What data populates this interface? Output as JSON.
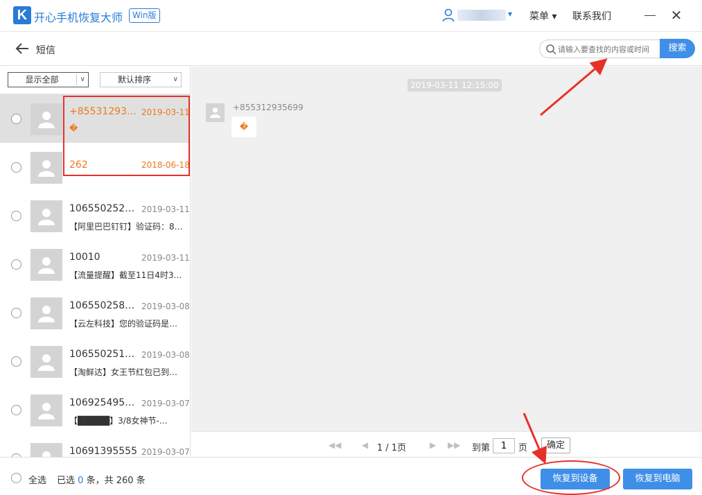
{
  "app": {
    "logo_letter": "K",
    "title": "开心手机恢复大师",
    "badge": "Win版",
    "user_caret": "▾",
    "menu": "菜单 ▾",
    "contact": "联系我们",
    "close": "✕"
  },
  "subbar": {
    "title": "短信",
    "search_placeholder": "请输入要查找的内容或时间",
    "search_button": "搜索"
  },
  "filters": {
    "show": "显示全部",
    "sort": "默认排序",
    "arrow": "∨"
  },
  "messages": [
    {
      "sender": "+8553129356…",
      "date": "2019-03-11",
      "preview": "�",
      "highlight": true,
      "selected": true
    },
    {
      "sender": "262",
      "date": "2018-06-18",
      "preview": "",
      "highlight": true,
      "selected": false
    },
    {
      "sender": "10655025230…",
      "date": "2019-03-11",
      "preview": "【阿里巴巴钉钉】验证码：8…",
      "highlight": false,
      "selected": false
    },
    {
      "sender": "10010",
      "date": "2019-03-11",
      "preview": "【流量提醒】截至11日4时35…",
      "highlight": false,
      "selected": false
    },
    {
      "sender": "10655025804…",
      "date": "2019-03-08",
      "preview": "【云左科技】您的验证码是…",
      "highlight": false,
      "selected": false
    },
    {
      "sender": "10655025160…",
      "date": "2019-03-08",
      "preview": "【淘鲜达】女王节红包已到…",
      "highlight": false,
      "selected": false
    },
    {
      "sender": "10692549589…",
      "date": "2019-03-07",
      "preview": "【█████】3/8女神节-…",
      "highlight": false,
      "selected": false
    },
    {
      "sender": "10691395555",
      "date": "2019-03-07",
      "preview": "",
      "highlight": false,
      "selected": false
    }
  ],
  "conversation": {
    "timestamp": "2019-03-11 12:15:00",
    "sender": "+855312935699",
    "body": "�"
  },
  "pager": {
    "first": "◀◀",
    "prev": "◀",
    "info": "1 / 1页",
    "next": "▶",
    "last": "▶▶",
    "goto": "到第",
    "page_value": "1",
    "unit": "页",
    "confirm": "确定"
  },
  "footer": {
    "select_all": "全选",
    "selected_prefix": "已选",
    "selected_count": "0",
    "selected_mid": "条，共",
    "total": "260",
    "total_suffix": "条",
    "restore_device": "恢复到设备",
    "restore_pc": "恢复到电脑"
  },
  "colors": {
    "accent": "#3f8fe8",
    "brand": "#2a7ad8",
    "highlight_text": "#ec7a1c",
    "annotation": "#e8302a"
  }
}
